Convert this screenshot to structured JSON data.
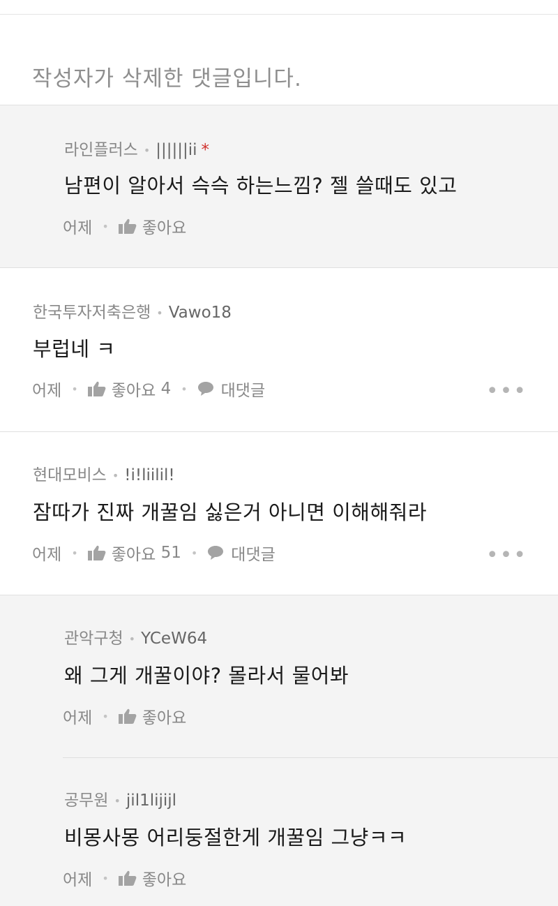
{
  "deleted_notice": "작성자가 삭제한 댓글입니다.",
  "comments": [
    {
      "company": "라인플러스",
      "nickname": "||||||ii",
      "author_mark": "*",
      "text": "남편이 알아서 슥슥 하는느낌? 젤 쓸때도 있고",
      "time": "어제",
      "like_label": "좋아요",
      "like_count": ""
    },
    {
      "company": "한국투자저축은행",
      "nickname": "Vawo18",
      "text": "부럽네 ㅋ",
      "time": "어제",
      "like_label": "좋아요",
      "like_count": "4",
      "reply_label": "대댓글"
    },
    {
      "company": "현대모비스",
      "nickname": "!i!liilil!",
      "text": "잠따가 진짜 개꿀임 싫은거 아니면 이해해줘라",
      "time": "어제",
      "like_label": "좋아요",
      "like_count": "51",
      "reply_label": "대댓글"
    },
    {
      "company": "관악구청",
      "nickname": "YCeW64",
      "text": "왜 그게 개꿀이야? 몰라서 물어봐",
      "time": "어제",
      "like_label": "좋아요",
      "like_count": ""
    },
    {
      "company": "공무원",
      "nickname": "jil1lijijl",
      "text": "비몽사몽 어리둥절한게 개꿀임 그냥ㅋㅋ",
      "time": "어제",
      "like_label": "좋아요",
      "like_count": ""
    }
  ],
  "icons": {
    "like": "thumbs-up-icon",
    "reply": "speech-bubble-icon",
    "more": "more-dots-icon"
  },
  "colors": {
    "author_mark": "#d0312d",
    "reply_bg": "#f4f4f4",
    "muted_text": "#888888"
  }
}
